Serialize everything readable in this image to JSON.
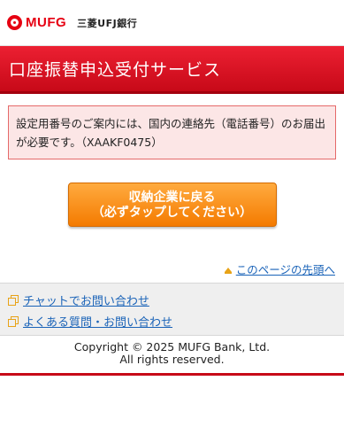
{
  "header": {
    "brand": "MUFG",
    "bank_name": "三菱UFJ銀行",
    "logo_icon": "mufg-logo-icon"
  },
  "page": {
    "title": "口座振替申込受付サービス"
  },
  "alert": {
    "message": "設定用番号のご案内には、国内の連絡先（電話番号）のお届出が必要です。（XAAKF0475）"
  },
  "actions": {
    "back_line1": "収納企業に戻る",
    "back_line2": "（必ずタップしてください）"
  },
  "pagetop": {
    "label": "このページの先頭へ",
    "icon": "arrow-up-icon"
  },
  "links": [
    {
      "label": "チャットでお問い合わせ",
      "icon": "external-window-icon"
    },
    {
      "label": "よくある質問・お問い合わせ",
      "icon": "external-window-icon"
    }
  ],
  "footer": {
    "copyright": "Copyright © 2025 MUFG Bank, Ltd.",
    "rights": "All rights reserved."
  },
  "colors": {
    "brand_red": "#e60012",
    "button_orange": "#f47b00",
    "link_blue": "#1a63b8",
    "alert_bg": "#fce6e6"
  }
}
